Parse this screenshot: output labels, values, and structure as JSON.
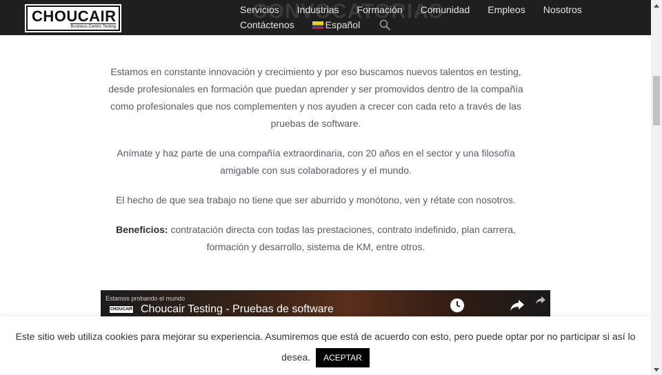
{
  "header": {
    "logo": {
      "brand": "CHOUCAIR",
      "tagline": "Business Centric Testing"
    },
    "background_heading": "CONVOCATORIAS",
    "nav": {
      "items": [
        "Servicios",
        "Industrias",
        "Formación",
        "Comunidad",
        "Empleos",
        "Nosotros",
        "Contáctenos"
      ],
      "language": "Español",
      "icons": {
        "language_flag": "colombia-flag-icon",
        "search": "search-icon"
      }
    }
  },
  "main": {
    "paragraphs": [
      "Estamos en constante innovación y crecimiento y por eso buscamos nuevos talentos en testing, desde profesionales en formación que puedan aprender y ser promovidos dentro de la compañía como profesionales que nos complementen y nos ayuden a crecer con cada reto a través de las pruebas de software.",
      "Anímate y haz parte de una compañía extraordinaria, con 20 años en el sector y una filosofía amigable con sus colaboradores y el mundo.",
      "El hecho de que sea trabajo no tiene que ser aburrido y monótono, ven y rétate con nosotros."
    ],
    "benefits": {
      "label": "Beneficios:",
      "text": " contratación directa con todas las prestaciones, contrato indefinido,  plan carrera, formación y desarrollo, sistema de KM, entre otros."
    }
  },
  "video": {
    "channel_text": "Estamos probando el mundo",
    "logo_text": "CHOUCAIR",
    "title": "Choucair Testing - Pruebas de software",
    "icons": {
      "watch_later": "clock-icon",
      "share": "share-icon"
    }
  },
  "cookie_banner": {
    "message": "Este sitio web utiliza cookies para mejorar su experiencia. Asumiremos que está de acuerdo con esto, pero puede optar por no participar si así lo desea.",
    "accept_label": "ACEPTAR"
  },
  "colors": {
    "topbar_bg": "#1f1f1f",
    "nav_text": "#e6e6e6",
    "body_text": "#5a5a6a",
    "button_bg": "#000000"
  }
}
